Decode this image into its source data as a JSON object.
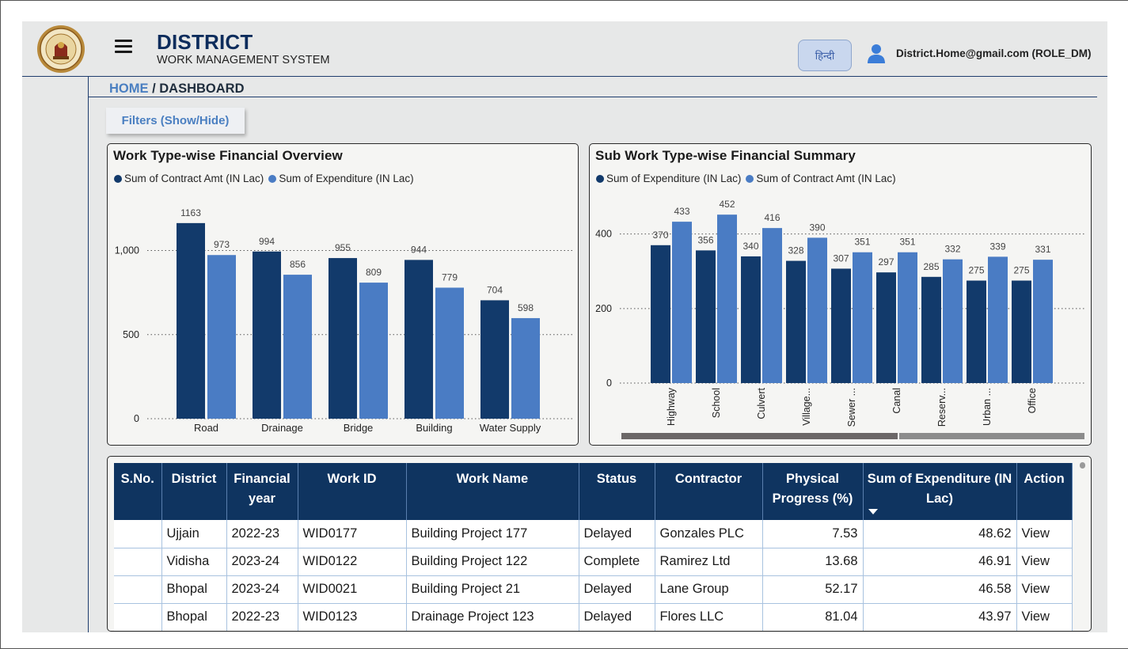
{
  "header": {
    "title": "DISTRICT",
    "subtitle": "WORK MANAGEMENT SYSTEM",
    "language_button": "हिन्दी",
    "user": "District.Home@gmail.com (ROLE_DM)"
  },
  "breadcrumb": {
    "home": "HOME",
    "separator": " / ",
    "current": "DASHBOARD"
  },
  "filters_button": "Filters (Show/Hide)",
  "colors": {
    "dark_bar": "#123a6b",
    "light_bar": "#4a7cc4",
    "header_bg": "#0f3460"
  },
  "chart_data": [
    {
      "type": "bar",
      "title": "Work Type-wise Financial Overview",
      "categories": [
        "Road",
        "Drainage",
        "Bridge",
        "Building",
        "Water Supply"
      ],
      "series": [
        {
          "name": "Sum of Contract Amt (IN Lac)",
          "values": [
            1163,
            994,
            955,
            944,
            704
          ]
        },
        {
          "name": "Sum of Expenditure (IN Lac)",
          "values": [
            973,
            856,
            809,
            779,
            598
          ]
        }
      ],
      "ylim": [
        0,
        1200
      ],
      "yticks": [
        0,
        500,
        1000
      ],
      "ytick_labels": [
        "0",
        "500",
        "1,000"
      ],
      "grid": true,
      "legend": "top-left"
    },
    {
      "type": "bar",
      "title": "Sub Work Type-wise Financial Summary",
      "categories": [
        "Highway",
        "School",
        "Culvert",
        "Village...",
        "Sewer ...",
        "Canal",
        "Reserv...",
        "Urban ...",
        "Office"
      ],
      "series": [
        {
          "name": "Sum of Expenditure (IN Lac)",
          "values": [
            370,
            356,
            340,
            328,
            307,
            297,
            285,
            275,
            275
          ]
        },
        {
          "name": "Sum of Contract Amt (IN Lac)",
          "values": [
            433,
            452,
            416,
            390,
            351,
            351,
            332,
            339,
            331
          ]
        }
      ],
      "ylim": [
        0,
        480
      ],
      "yticks": [
        0,
        200,
        400
      ],
      "ytick_labels": [
        "0",
        "200",
        "400"
      ],
      "grid": true,
      "legend": "top-left"
    }
  ],
  "table": {
    "columns": [
      "S.No.",
      "District",
      "Financial year",
      "Work ID",
      "Work Name",
      "Status",
      "Contractor",
      "Physical Progress (%)",
      "Sum of Expenditure (IN Lac)",
      "Action"
    ],
    "rows": [
      [
        "",
        "Ujjain",
        "2022-23",
        "WID0177",
        "Building Project 177",
        "Delayed",
        "Gonzales PLC",
        "7.53",
        "48.62",
        "View"
      ],
      [
        "",
        "Vidisha",
        "2023-24",
        "WID0122",
        "Building Project 122",
        "Complete",
        "Ramirez Ltd",
        "13.68",
        "46.91",
        "View"
      ],
      [
        "",
        "Bhopal",
        "2023-24",
        "WID0021",
        "Building Project 21",
        "Delayed",
        "Lane Group",
        "52.17",
        "46.58",
        "View"
      ],
      [
        "",
        "Bhopal",
        "2022-23",
        "WID0123",
        "Drainage Project 123",
        "Delayed",
        "Flores LLC",
        "81.04",
        "43.97",
        "View"
      ]
    ]
  }
}
